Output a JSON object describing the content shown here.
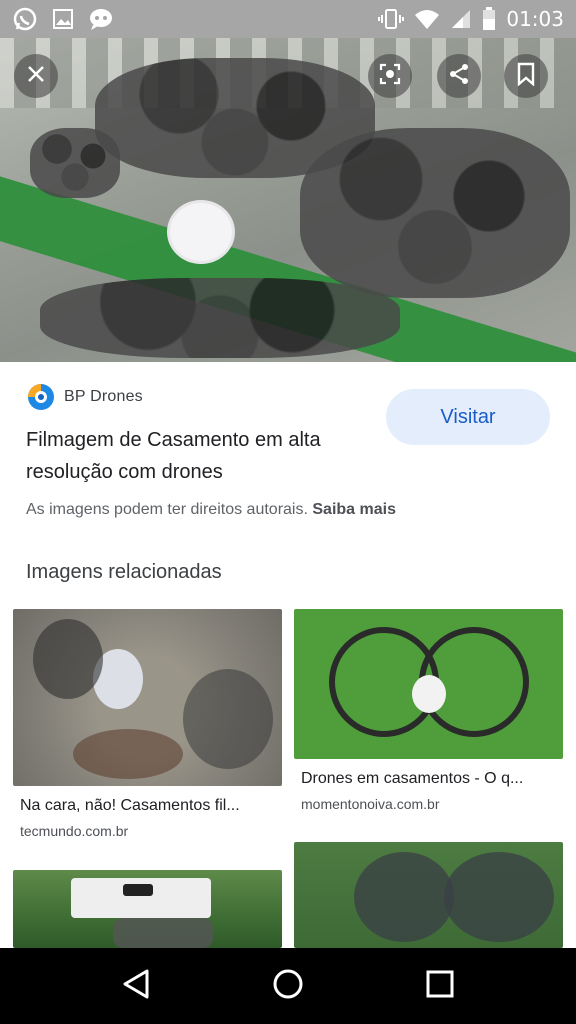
{
  "status_bar": {
    "time": "01:03",
    "left_icons": [
      "whatsapp-icon",
      "gallery-icon",
      "chat-game-icon"
    ],
    "right_icons": [
      "vibrate-icon",
      "wifi-icon",
      "signal-icon",
      "battery-icon"
    ]
  },
  "hero": {
    "buttons": [
      "close-icon",
      "lens-icon",
      "share-icon",
      "bookmark-icon"
    ]
  },
  "source": {
    "name": "BP Drones",
    "visit_label": "Visitar",
    "title": "Filmagem de Casamento em alta resolução com drones",
    "copyright_text": "As imagens podem ter direitos autorais.",
    "learn_more": "Saiba mais"
  },
  "related": {
    "section_title": "Imagens relacionadas",
    "items": [
      {
        "title": "Na cara, não! Casamentos fil...",
        "domain": "tecmundo.com.br"
      },
      {
        "title": "Drones em casamentos - O q...",
        "domain": "momentonoiva.com.br"
      },
      {
        "title": "",
        "domain": ""
      },
      {
        "title": "",
        "domain": ""
      }
    ]
  },
  "nav_bar": {
    "buttons": [
      "back-icon",
      "home-icon",
      "recents-icon"
    ]
  },
  "colors": {
    "status_bar": "#a6a6a6",
    "accent": "#1a5dc8",
    "visit_bg": "#e3edfb",
    "lawn": "#2f8f3d"
  }
}
